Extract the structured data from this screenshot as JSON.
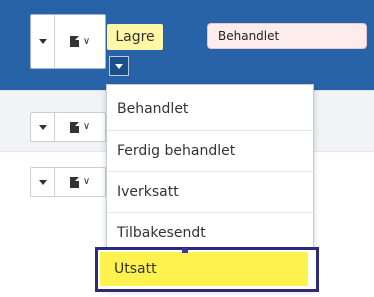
{
  "toolbar": {
    "save_label": "Lagre",
    "status_value": "Behandlet"
  },
  "status_menu": {
    "options": [
      "Behandlet",
      "Ferdig behandlet",
      "Iverksatt",
      "Tilbakesendt",
      "Utsatt"
    ],
    "selected": "Utsatt"
  },
  "colors": {
    "header": "#2863a8",
    "save_button": "#fef7a8",
    "status_field": "#fdecec",
    "selected_option": "#fff24f",
    "focus_frame": "#2f2a77"
  }
}
